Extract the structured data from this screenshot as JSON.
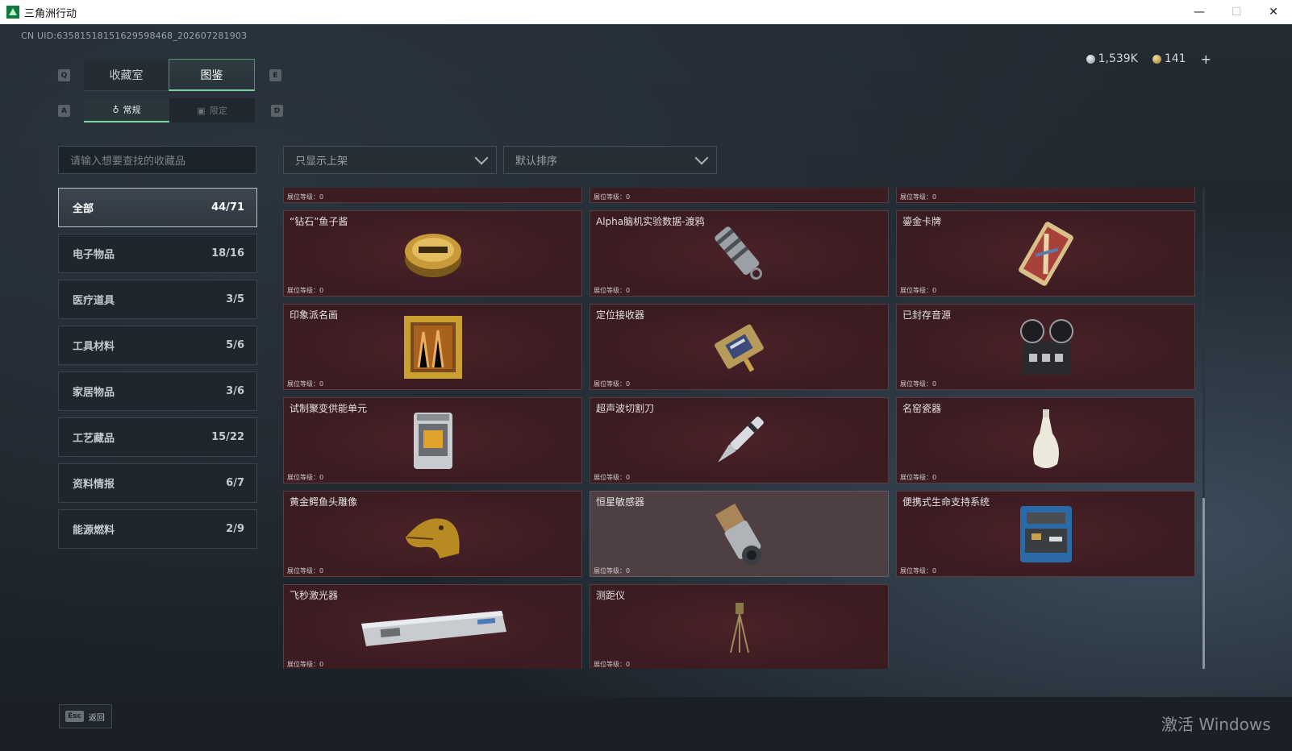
{
  "window": {
    "title": "三角洲行动",
    "minimize": "—",
    "maximize": "☐",
    "close": "✕"
  },
  "uid": "CN UID:6358151815162959846​8_202607281903",
  "currency": {
    "silver": "1,539K",
    "gold": "141",
    "plus": "+"
  },
  "keys": {
    "q": "Q",
    "e": "E",
    "a": "A",
    "d": "D"
  },
  "tabs": [
    {
      "label": "收藏室"
    },
    {
      "label": "图鉴"
    }
  ],
  "subtabs": [
    {
      "label": "常规",
      "icon": "♁"
    },
    {
      "label": "限定",
      "icon": "▣"
    }
  ],
  "search": {
    "placeholder": "请输入想要查找的收藏品"
  },
  "filters": {
    "display": "只显示上架",
    "sort": "默认排序"
  },
  "categories": [
    {
      "name": "全部",
      "count": "44/71"
    },
    {
      "name": "电子物品",
      "count": "18/16"
    },
    {
      "name": "医疗道具",
      "count": "3/5"
    },
    {
      "name": "工具材料",
      "count": "5/6"
    },
    {
      "name": "家居物品",
      "count": "3/6"
    },
    {
      "name": "工艺藏品",
      "count": "15/22"
    },
    {
      "name": "资料情报",
      "count": "6/7"
    },
    {
      "name": "能源燃料",
      "count": "2/9"
    }
  ],
  "level_label": "展位等级：0",
  "items": [
    {
      "name": ""
    },
    {
      "name": ""
    },
    {
      "name": ""
    },
    {
      "name": "“钻石”鱼子酱",
      "icon": "caviar-tin-icon"
    },
    {
      "name": "Alpha脑机实验数据-渡鸦",
      "icon": "data-canister-icon"
    },
    {
      "name": "鎏金卡牌",
      "icon": "gilded-card-icon"
    },
    {
      "name": "印象派名画",
      "icon": "framed-painting-icon"
    },
    {
      "name": "定位接收器",
      "icon": "gps-receiver-icon"
    },
    {
      "name": "已封存音源",
      "icon": "reel-recorder-icon"
    },
    {
      "name": "试制聚变供能单元",
      "icon": "fusion-cell-icon"
    },
    {
      "name": "超声波切割刀",
      "icon": "ultrasonic-knife-icon"
    },
    {
      "name": "名窑瓷器",
      "icon": "porcelain-vase-icon"
    },
    {
      "name": "黄金鳄鱼头雕像",
      "icon": "golden-crocodile-icon"
    },
    {
      "name": "恒星敏感器",
      "icon": "star-sensor-icon"
    },
    {
      "name": "便携式生命支持系统",
      "icon": "life-support-icon"
    },
    {
      "name": "飞秒激光器",
      "icon": "femtosecond-laser-icon"
    },
    {
      "name": "测距仪",
      "icon": "rangefinder-tripod-icon"
    }
  ],
  "footer": {
    "esc_key": "Esc",
    "back_label": "返回"
  },
  "watermark": "激活 Windows"
}
